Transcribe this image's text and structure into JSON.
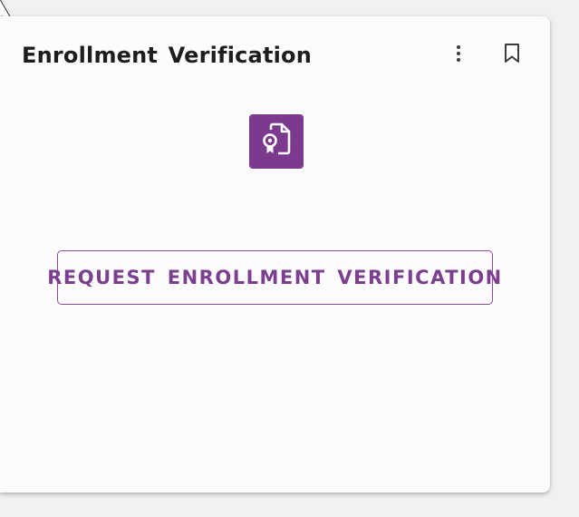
{
  "card": {
    "title": "Enrollment Verification",
    "more_icon": "more-vertical-icon",
    "bookmark_icon": "bookmark-outline-icon",
    "app_icon": "certificate-document-icon",
    "request_button_label": "REQUEST ENROLLMENT VERIFICATION"
  },
  "colors": {
    "accent": "#7b3a8e",
    "button_border": "#8b4a9e",
    "button_text": "#7c3f8f",
    "title_text": "#1d1d1f",
    "card_bg": "#fdfcfd",
    "page_bg": "#f1f1f2"
  }
}
